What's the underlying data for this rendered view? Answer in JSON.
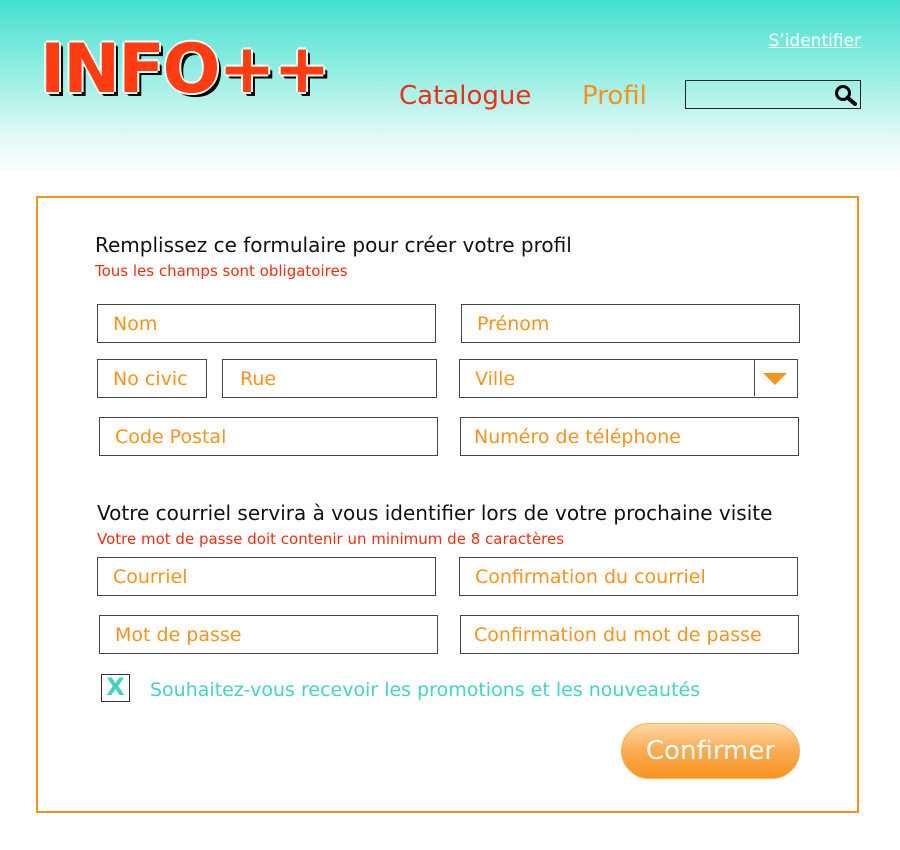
{
  "header": {
    "logo": "INFO++",
    "signin_label": "S’identifier",
    "nav": {
      "catalogue": "Catalogue",
      "profil": "Profil"
    },
    "search": {
      "value": "",
      "icon": "search-icon"
    }
  },
  "form": {
    "section1": {
      "heading": "Remplissez ce formulaire pour créer votre profil",
      "note": "Tous les champs sont obligatoires",
      "fields": {
        "nom": "Nom",
        "prenom": "Prénom",
        "no_civic": "No civic",
        "rue": "Rue",
        "ville": "Ville",
        "code_postal": "Code Postal",
        "telephone": "Numéro de téléphone"
      }
    },
    "section2": {
      "heading": "Votre courriel servira à vous identifier lors de votre prochaine visite",
      "note": "Votre mot de passe doit contenir un minimum de 8 caractères",
      "fields": {
        "courriel": "Courriel",
        "confirm_courriel": "Confirmation du courriel",
        "mot_de_passe": "Mot de passe",
        "confirm_mot_de_passe": "Confirmation du mot de passe"
      }
    },
    "promo": {
      "checked_mark": "X",
      "label": "Souhaitez-vous recevoir les promotions et les nouveautés"
    },
    "confirm_label": "Confirmer"
  },
  "colors": {
    "accent_orange": "#f7921d",
    "accent_red": "#ef2e10",
    "accent_teal": "#44d3c3"
  }
}
